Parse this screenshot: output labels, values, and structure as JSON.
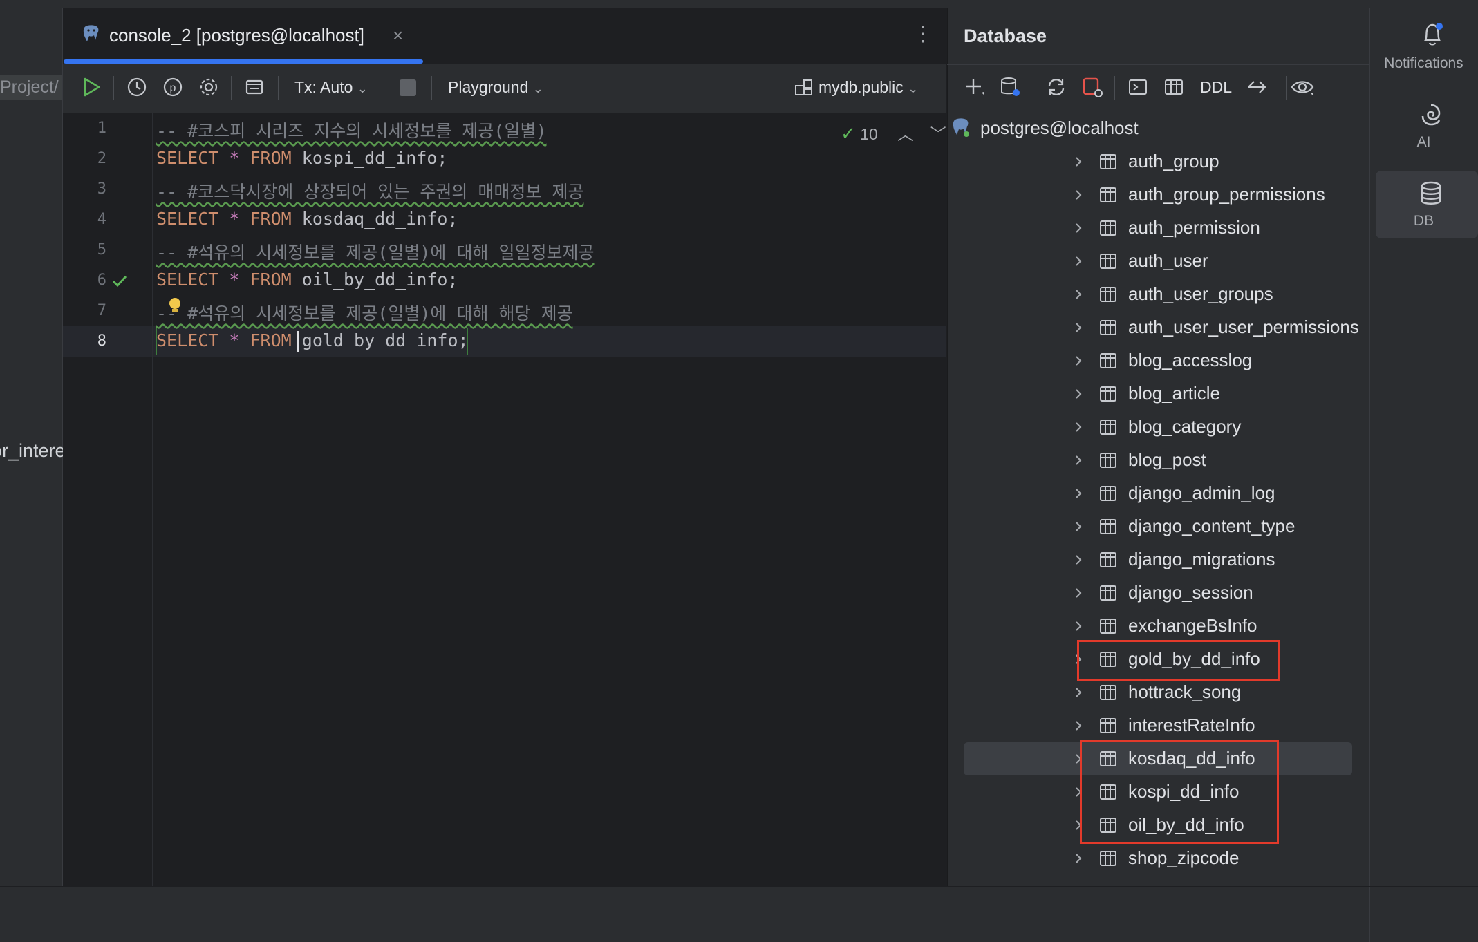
{
  "left_panel": {
    "project_label": "Project/",
    "truncated_item": "or_intere"
  },
  "editor": {
    "tab_title": "console_2 [postgres@localhost]",
    "tab_close": "×",
    "tab_menu": "⋮",
    "toolbar": {
      "tx_mode": "Tx: Auto",
      "playground": "Playground",
      "schema": "mydb.public"
    },
    "inspection_count": "10",
    "lines": [
      {
        "num": "1",
        "text": "-- #코스피 시리즈 지수의 시세정보를 제공(일별)"
      },
      {
        "num": "2",
        "sql": [
          "SELECT",
          " ",
          "*",
          " ",
          "FROM",
          " kospi_dd_info;"
        ]
      },
      {
        "num": "3",
        "text": "-- #코스닥시장에 상장되어 있는 주권의 매매정보 제공"
      },
      {
        "num": "4",
        "sql": [
          "SELECT",
          " ",
          "*",
          " ",
          "FROM",
          " kosdaq_dd_info;"
        ]
      },
      {
        "num": "5",
        "text": "-- #석유의 시세정보를 제공(일별)에 대해 일일정보제공"
      },
      {
        "num": "6",
        "sql": [
          "SELECT",
          " ",
          "*",
          " ",
          "FROM",
          " oil_by_dd_info;"
        ]
      },
      {
        "num": "7",
        "text": "-- #석유의 시세정보를 제공(일별)에 대해 해당 제공"
      },
      {
        "num": "8",
        "sql": [
          "SELECT",
          " ",
          "*",
          " ",
          "FROM",
          " gold_by_dd_info;"
        ]
      }
    ]
  },
  "database_panel": {
    "title": "Database",
    "ddl_label": "DDL",
    "root": "postgres@localhost",
    "tables": [
      "auth_group",
      "auth_group_permissions",
      "auth_permission",
      "auth_user",
      "auth_user_groups",
      "auth_user_user_permissions",
      "blog_accesslog",
      "blog_article",
      "blog_category",
      "blog_post",
      "django_admin_log",
      "django_content_type",
      "django_migrations",
      "django_session",
      "exchangeBsInfo",
      "gold_by_dd_info",
      "hottrack_song",
      "interestRateInfo",
      "kosdaq_dd_info",
      "kospi_dd_info",
      "oil_by_dd_info",
      "shop_zipcode"
    ],
    "selected_table": "kosdaq_dd_info",
    "highlighted_tables": [
      "gold_by_dd_info",
      "kosdaq_dd_info",
      "kospi_dd_info",
      "oil_by_dd_info"
    ]
  },
  "right_rail": {
    "notifications": "Notifications",
    "ai": "AI",
    "db": "DB"
  },
  "colors": {
    "accent": "#3574f0",
    "keyword": "#cf8e6d",
    "comment": "#7a7e85",
    "highlight_box": "#e23a2b",
    "run_green": "#5fb85a"
  }
}
